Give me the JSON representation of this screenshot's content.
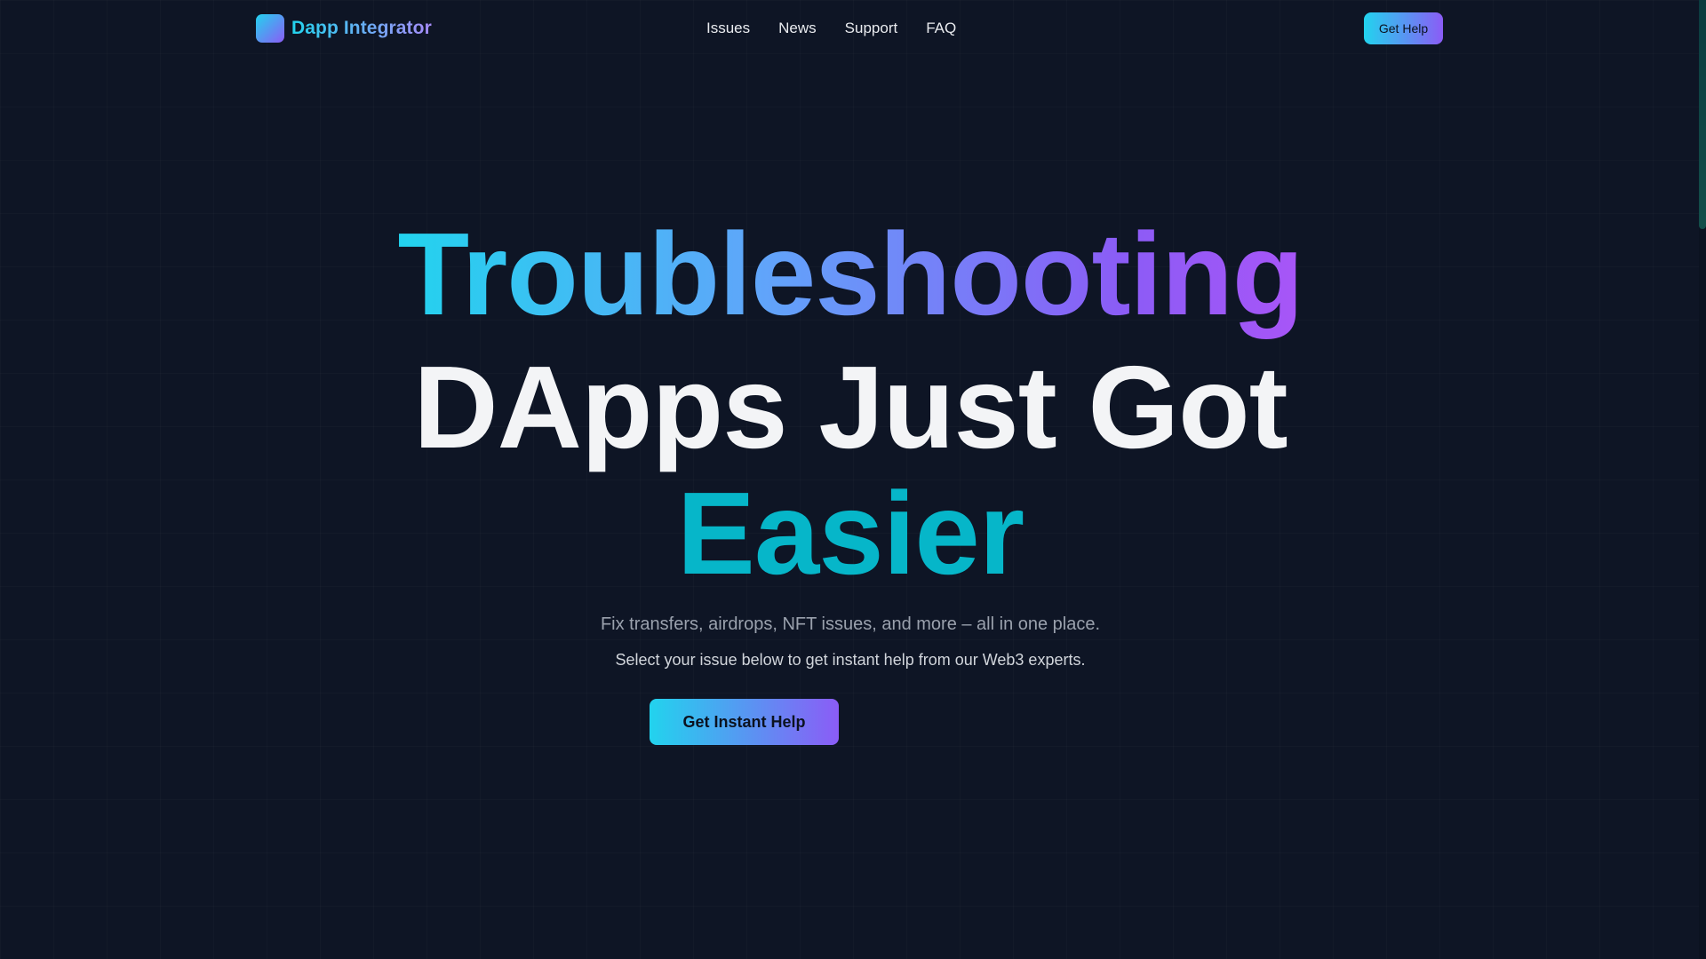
{
  "navbar": {
    "brand": "Dapp Integrator",
    "links": [
      "Issues",
      "News",
      "Support",
      "FAQ"
    ],
    "cta_label": "Get Help"
  },
  "hero": {
    "headline_line1": "Troubleshooting",
    "headline_line2": "DApps Just Got",
    "headline_line3": "Easier",
    "subtitle": "Fix transfers, airdrops, NFT issues, and more – all in one place.",
    "subtitle2": "Select your issue below to get instant help from our Web3 experts.",
    "cta_label": "Get Instant Help"
  },
  "colors": {
    "background": "#0e1525",
    "accent_cyan": "#22d3ee",
    "accent_purple": "#8b5cf6",
    "teal": "#06b6c9"
  },
  "icons": {
    "logo": "gradient-square-logo"
  }
}
